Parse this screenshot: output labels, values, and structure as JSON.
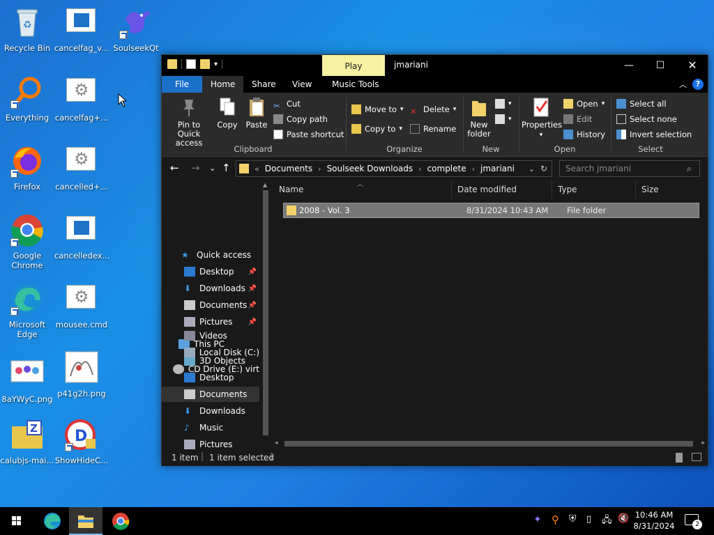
{
  "desktop": {
    "icons": [
      {
        "label": "Recycle Bin"
      },
      {
        "label": "cancelfag_v..."
      },
      {
        "label": "SoulseekQt"
      },
      {
        "label": "Everything"
      },
      {
        "label": "cancelfag+..."
      },
      {
        "label": "Firefox"
      },
      {
        "label": "cancelled+..."
      },
      {
        "label": "Google Chrome"
      },
      {
        "label": "cancelledex..."
      },
      {
        "label": "Microsoft Edge"
      },
      {
        "label": "mousee.cmd"
      },
      {
        "label": "8aYWyC.png"
      },
      {
        "label": "p41g2h.png"
      },
      {
        "label": "calubjs-mai..."
      },
      {
        "label": "ShowHideC..."
      }
    ]
  },
  "window": {
    "context_tab": "Play",
    "title": "jmariani",
    "ribbon_tabs": [
      "File",
      "Home",
      "Share",
      "View",
      "Music Tools"
    ],
    "ribbon": {
      "pin": "Pin to Quick access",
      "copy": "Copy",
      "paste": "Paste",
      "cut": "Cut",
      "copy_path": "Copy path",
      "paste_shortcut": "Paste shortcut",
      "clipboard": "Clipboard",
      "move_to": "Move to",
      "copy_to": "Copy to",
      "delete": "Delete",
      "rename": "Rename",
      "organize": "Organize",
      "new_folder": "New folder",
      "new": "New",
      "properties": "Properties",
      "open": "Open",
      "edit": "Edit",
      "history": "History",
      "open_group": "Open",
      "select_all": "Select all",
      "select_none": "Select none",
      "invert_selection": "Invert selection",
      "select_group": "Select"
    },
    "address": {
      "crumbs": [
        "Documents",
        "Soulseek Downloads",
        "complete",
        "jmariani"
      ],
      "search_placeholder": "Search jmariani"
    },
    "nav": {
      "quick_access": "Quick access",
      "qa_items": [
        "Desktop",
        "Downloads",
        "Documents",
        "Pictures"
      ],
      "this_pc": "This PC",
      "pc_items": [
        "3D Objects",
        "Desktop",
        "Documents",
        "Downloads",
        "Music",
        "Pictures",
        "Videos",
        "Local Disk (C:)",
        "CD Drive (E:) virt"
      ]
    },
    "columns": [
      "Name",
      "Date modified",
      "Type",
      "Size"
    ],
    "files": [
      {
        "name": "2008 - Vol. 3",
        "date": "8/31/2024 10:43 AM",
        "type": "File folder",
        "size": ""
      }
    ],
    "status": {
      "count": "1 item",
      "selected": "1 item selected"
    }
  },
  "taskbar": {
    "time": "10:46 AM",
    "date": "8/31/2024",
    "notifications": "2"
  }
}
